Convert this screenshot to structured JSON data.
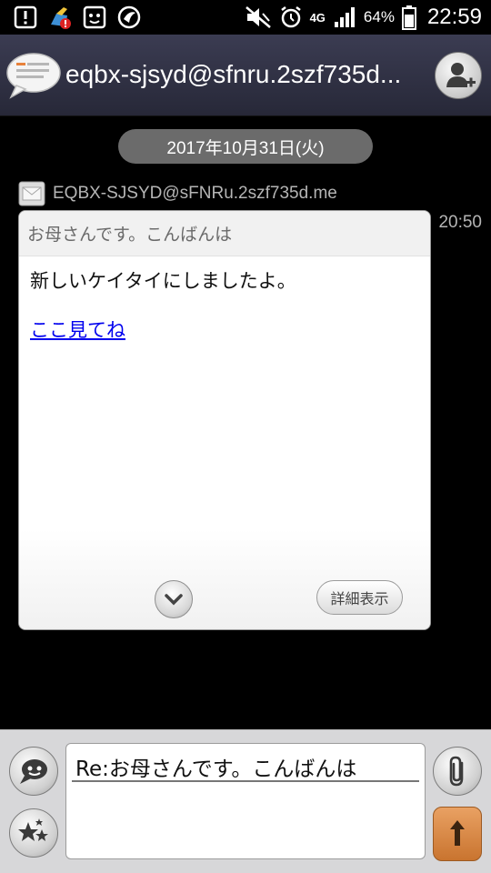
{
  "status_bar": {
    "battery_percent": "64%",
    "network": "4G",
    "time": "22:59",
    "left_icons": [
      "notification-icon",
      "cleaner-icon",
      "face-icon",
      "shield-app-icon"
    ],
    "right_icons": [
      "mute-icon",
      "alarm-icon",
      "signal-icon",
      "battery-icon"
    ]
  },
  "header": {
    "title": "eqbx-sjsyd@sfnru.2szf735d...",
    "logo_icon": "message-bubble-icon",
    "add_contact_icon": "add-contact-icon"
  },
  "thread": {
    "date": "2017年10月31日(火)",
    "sender": "EQBX-SJSYD@sFNRu.2szf735d.me",
    "time": "20:50",
    "message": {
      "subject": "お母さんです。こんばんは",
      "body": "新しいケイタイにしましたよ。",
      "link": "ここ見てね",
      "details_label": "詳細表示"
    }
  },
  "compose": {
    "text": "Re:お母さんです。こんばんは",
    "icons": [
      "emoji-icon",
      "decoration-icon",
      "attachment-icon",
      "send-icon"
    ]
  },
  "colors": {
    "header_bg": "#30313f",
    "link": "#0000ee",
    "send_button": "#d8894a"
  }
}
